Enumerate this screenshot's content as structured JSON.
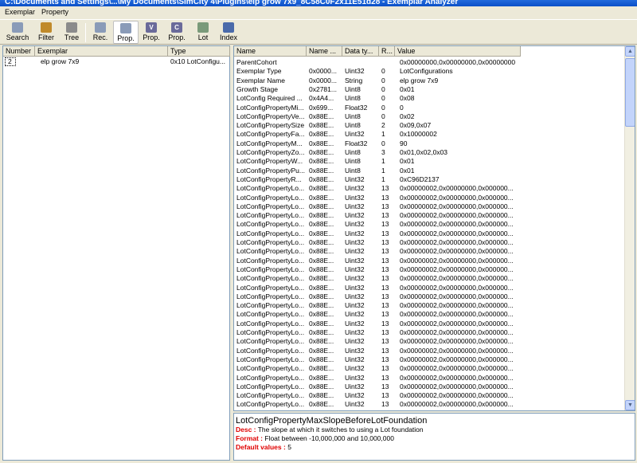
{
  "window": {
    "title": "C:\\Documents and Settings\\...\\My Documents\\SimCity 4\\Plugins\\elp grow 7x9_8C58C0F2x11E51d28 - Exemplar Analyzer"
  },
  "menu": [
    "Exemplar",
    "Property"
  ],
  "toolbar": [
    {
      "label": "Search",
      "icon": "search-icon",
      "color": "#8a9bb8"
    },
    {
      "label": "Filter",
      "icon": "filter-icon",
      "color": "#c08a2a"
    },
    {
      "label": "Tree",
      "icon": "tree-icon",
      "color": "#8b8b8b"
    },
    {
      "label": "Rec.",
      "icon": "record-icon",
      "color": "#8a9bb8"
    },
    {
      "label": "Prop.",
      "icon": "property-icon",
      "color": "#8a9bb8",
      "active": true
    },
    {
      "label": "Prop.",
      "icon": "property-v-icon",
      "color": "#6a6a9a",
      "glyph": "V"
    },
    {
      "label": "Prop.",
      "icon": "property-c-icon",
      "color": "#6a6a9a",
      "glyph": "C"
    },
    {
      "label": "Lot",
      "icon": "lot-icon",
      "color": "#7a9a7a"
    },
    {
      "label": "Index",
      "icon": "index-icon",
      "color": "#4a6aaa"
    }
  ],
  "left_table": {
    "columns": [
      "Number",
      "Exemplar",
      "Type"
    ],
    "rows": [
      [
        "2",
        "elp grow 7x9",
        "0x10 LotConfigu..."
      ]
    ]
  },
  "right_table": {
    "columns": [
      "Name",
      "Name ...",
      "Data ty...",
      "R...",
      "Value"
    ],
    "rows": [
      [
        "ParentCohort",
        "",
        "",
        "",
        "0x00000000,0x00000000,0x00000000"
      ],
      [
        "Exemplar Type",
        "0x0000...",
        "Uint32",
        "0",
        "LotConfigurations"
      ],
      [
        "Exemplar Name",
        "0x0000...",
        "String",
        "0",
        "elp grow 7x9"
      ],
      [
        "Growth Stage",
        "0x2781...",
        "Uint8",
        "0",
        "0x01"
      ],
      [
        "LotConfig Required ...",
        "0x4A4...",
        "Uint8",
        "0",
        "0x08"
      ],
      [
        "LotConfigPropertyMi...",
        "0x699...",
        "Float32",
        "0",
        "0"
      ],
      [
        "LotConfigPropertyVe...",
        "0x88E...",
        "Uint8",
        "0",
        "0x02"
      ],
      [
        "LotConfigPropertySize",
        "0x88E...",
        "Uint8",
        "2",
        "0x09,0x07"
      ],
      [
        "LotConfigPropertyFa...",
        "0x88E...",
        "Uint32",
        "1",
        "0x10000002"
      ],
      [
        "LotConfigPropertyM...",
        "0x88E...",
        "Float32",
        "0",
        "90"
      ],
      [
        "LotConfigPropertyZo...",
        "0x88E...",
        "Uint8",
        "3",
        "0x01,0x02,0x03"
      ],
      [
        "LotConfigPropertyW...",
        "0x88E...",
        "Uint8",
        "1",
        "0x01"
      ],
      [
        "LotConfigPropertyPu...",
        "0x88E...",
        "Uint8",
        "1",
        "0x01"
      ],
      [
        "LotConfigPropertyR...",
        "0x88E...",
        "Uint32",
        "1",
        "0xC96D2137"
      ],
      [
        "LotConfigPropertyLo...",
        "0x88E...",
        "Uint32",
        "13",
        "0x00000002,0x00000000,0x000000..."
      ],
      [
        "LotConfigPropertyLo...",
        "0x88E...",
        "Uint32",
        "13",
        "0x00000002,0x00000000,0x000000..."
      ],
      [
        "LotConfigPropertyLo...",
        "0x88E...",
        "Uint32",
        "13",
        "0x00000002,0x00000000,0x000000..."
      ],
      [
        "LotConfigPropertyLo...",
        "0x88E...",
        "Uint32",
        "13",
        "0x00000002,0x00000000,0x000000..."
      ],
      [
        "LotConfigPropertyLo...",
        "0x88E...",
        "Uint32",
        "13",
        "0x00000002,0x00000000,0x000000..."
      ],
      [
        "LotConfigPropertyLo...",
        "0x88E...",
        "Uint32",
        "13",
        "0x00000002,0x00000000,0x000000..."
      ],
      [
        "LotConfigPropertyLo...",
        "0x88E...",
        "Uint32",
        "13",
        "0x00000002,0x00000000,0x000000..."
      ],
      [
        "LotConfigPropertyLo...",
        "0x88E...",
        "Uint32",
        "13",
        "0x00000002,0x00000000,0x000000..."
      ],
      [
        "LotConfigPropertyLo...",
        "0x88E...",
        "Uint32",
        "13",
        "0x00000002,0x00000000,0x000000..."
      ],
      [
        "LotConfigPropertyLo...",
        "0x88E...",
        "Uint32",
        "13",
        "0x00000002,0x00000000,0x000000..."
      ],
      [
        "LotConfigPropertyLo...",
        "0x88E...",
        "Uint32",
        "13",
        "0x00000002,0x00000000,0x000000..."
      ],
      [
        "LotConfigPropertyLo...",
        "0x88E...",
        "Uint32",
        "13",
        "0x00000002,0x00000000,0x000000..."
      ],
      [
        "LotConfigPropertyLo...",
        "0x88E...",
        "Uint32",
        "13",
        "0x00000002,0x00000000,0x000000..."
      ],
      [
        "LotConfigPropertyLo...",
        "0x88E...",
        "Uint32",
        "13",
        "0x00000002,0x00000000,0x000000..."
      ],
      [
        "LotConfigPropertyLo...",
        "0x88E...",
        "Uint32",
        "13",
        "0x00000002,0x00000000,0x000000..."
      ],
      [
        "LotConfigPropertyLo...",
        "0x88E...",
        "Uint32",
        "13",
        "0x00000002,0x00000000,0x000000..."
      ],
      [
        "LotConfigPropertyLo...",
        "0x88E...",
        "Uint32",
        "13",
        "0x00000002,0x00000000,0x000000..."
      ],
      [
        "LotConfigPropertyLo...",
        "0x88E...",
        "Uint32",
        "13",
        "0x00000002,0x00000000,0x000000..."
      ],
      [
        "LotConfigPropertyLo...",
        "0x88E...",
        "Uint32",
        "13",
        "0x00000002,0x00000000,0x000000..."
      ],
      [
        "LotConfigPropertyLo...",
        "0x88E...",
        "Uint32",
        "13",
        "0x00000002,0x00000000,0x000000..."
      ],
      [
        "LotConfigPropertyLo...",
        "0x88E...",
        "Uint32",
        "13",
        "0x00000002,0x00000000,0x000000..."
      ],
      [
        "LotConfigPropertyLo...",
        "0x88E...",
        "Uint32",
        "13",
        "0x00000002,0x00000000,0x000000..."
      ],
      [
        "LotConfigPropertyLo...",
        "0x88E...",
        "Uint32",
        "13",
        "0x00000002,0x00000000,0x000000..."
      ],
      [
        "LotConfigPropertyLo...",
        "0x88E...",
        "Uint32",
        "13",
        "0x00000002,0x00000000,0x000000..."
      ],
      [
        "LotConfigPropertyLo...",
        "0x88E...",
        "Uint32",
        "13",
        "0x00000002,0x00000000,0x000000..."
      ],
      [
        "LotConfigPropertyLo...",
        "0x88E...",
        "Uint32",
        "13",
        "0x00000002,0x00000000,0x000000..."
      ],
      [
        "LotConfigPropertyLo...",
        "0x88E...",
        "Uint32",
        "13",
        "0x00000002,0x00000000,0x000000..."
      ],
      [
        "LotConfigPropertyLo...",
        "0x88E...",
        "Uint32",
        "13",
        "0x00000002,0x00000000,0x000000..."
      ],
      [
        "LotConfigPropertyLo...",
        "0x88E...",
        "Uint32",
        "13",
        "0x00000002,0x00000000,0x000000..."
      ],
      [
        "LotConfigPropertyLo...",
        "0x88E...",
        "Uint32",
        "13",
        "0x00000002,0x00000000,0x000000..."
      ]
    ]
  },
  "description": {
    "title": "LotConfigPropertyMaxSlopeBeforeLotFoundation",
    "desc_label": "Desc :",
    "desc": "The slope at which it switches to using a Lot foundation",
    "format_label": "Format :",
    "format": "Float between -10,000,000 and 10,000,000",
    "default_label": "Default values :",
    "default": "5"
  },
  "colors": {
    "xp_blue": "#0a5bdc",
    "face": "#ece9d8",
    "border": "#7f9db9",
    "desc_key": "#e00000"
  }
}
